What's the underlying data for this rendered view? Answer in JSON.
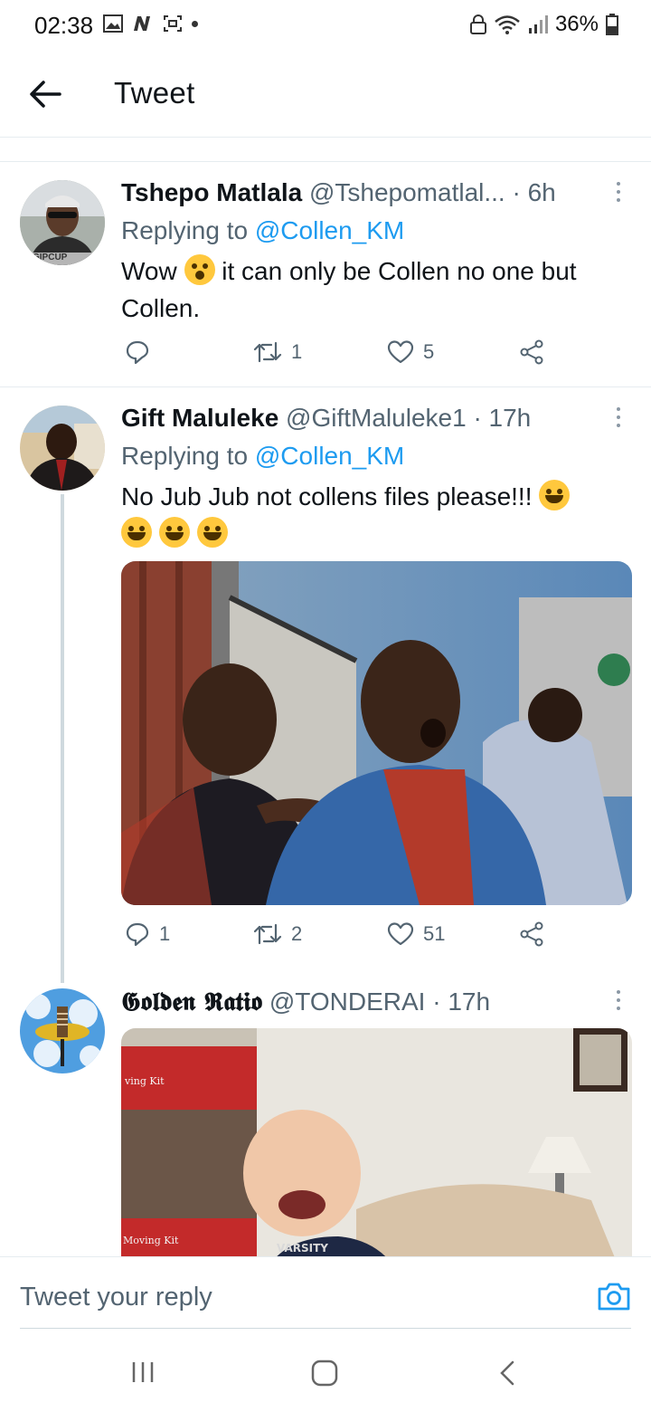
{
  "status_bar": {
    "time": "02:38",
    "battery": "36%"
  },
  "header": {
    "title": "Tweet"
  },
  "tweets": [
    {
      "name": "Tshepo Matlala",
      "handle": "@Tshepomatlal...",
      "time": "· 6h",
      "replying_prefix": "Replying to",
      "replying_to": "@Collen_KM",
      "text_before": "Wow",
      "text_after": "it can only be Collen no one but Collen.",
      "avatar_caption": "GIPCUP",
      "stats": {
        "replies": "",
        "retweets": "1",
        "likes": "5"
      }
    },
    {
      "name": "Gift Maluleke",
      "handle": "@GiftMaluleke1",
      "time": "· 17h",
      "replying_prefix": "Replying to",
      "replying_to": "@Collen_KM",
      "text": "No Jub Jub not collens files please!!!",
      "stats": {
        "replies": "1",
        "retweets": "2",
        "likes": "51"
      }
    },
    {
      "name": "𝕲𝖔𝖑𝖉𝖊𝖓 𝕽𝖆𝖙𝖎𝖔",
      "handle": "@TONDERAI",
      "time": "· 17h",
      "image_text_1": "ving Kit",
      "image_text_2": "Moving Kit",
      "image_text_3": "VARSITY"
    }
  ],
  "reply_bar": {
    "placeholder": "Tweet your reply"
  },
  "icons": {
    "back": "arrow-left-icon",
    "camera": "camera-icon",
    "reply": "speech-bubble-icon",
    "retweet": "retweet-icon",
    "like": "heart-icon",
    "share": "share-icon"
  },
  "colors": {
    "accent": "#1d9bf0",
    "muted": "#536471",
    "text": "#0f1419"
  }
}
